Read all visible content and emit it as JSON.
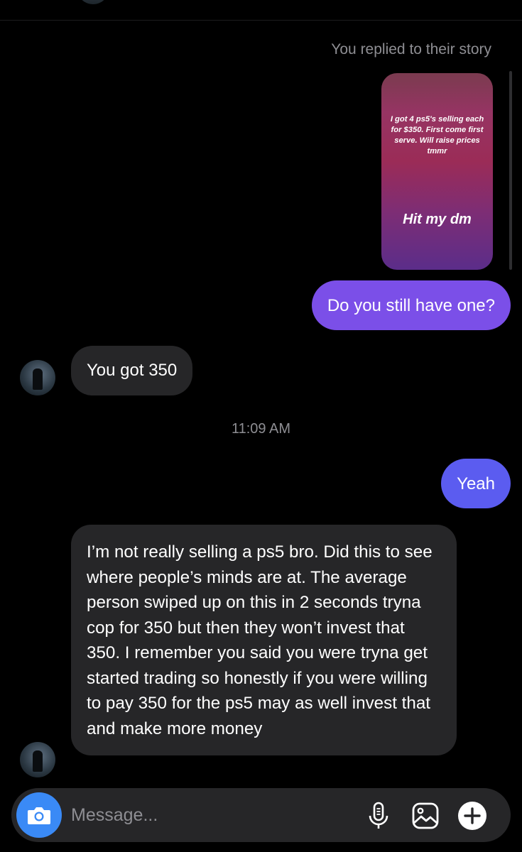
{
  "thread": {
    "story_reply_note": "You replied to their story",
    "story": {
      "text": "I got 4 ps5's selling each for $350. First come first serve. Will raise prices tmmr",
      "cta": "Hit my dm"
    },
    "messages": [
      {
        "sender": "me",
        "text": "Do you still have one?"
      },
      {
        "sender": "them",
        "text": "You got 350"
      },
      {
        "sender": "me",
        "text": "Yeah"
      },
      {
        "sender": "them",
        "text": "I’m not really selling a ps5 bro.  Did this to see where people’s minds are at. The average person swiped up on this in 2 seconds tryna cop for 350 but then they won’t invest that 350. I remember you said you were tryna get started trading so honestly if you were willing to pay 350 for the ps5 may as well invest that and make more money"
      }
    ],
    "timestamp": "11:09 AM"
  },
  "composer": {
    "placeholder": "Message...",
    "value": "",
    "icons": [
      "camera-icon",
      "microphone-icon",
      "gallery-icon",
      "plus-icon"
    ]
  },
  "colors": {
    "background": "#000000",
    "outgoing_bubble_1": "#7b4fe8",
    "outgoing_bubble_2": "#5b5cf0",
    "incoming_bubble": "#262628",
    "camera_button": "#3a8af6",
    "secondary_text": "#8e8e93"
  }
}
